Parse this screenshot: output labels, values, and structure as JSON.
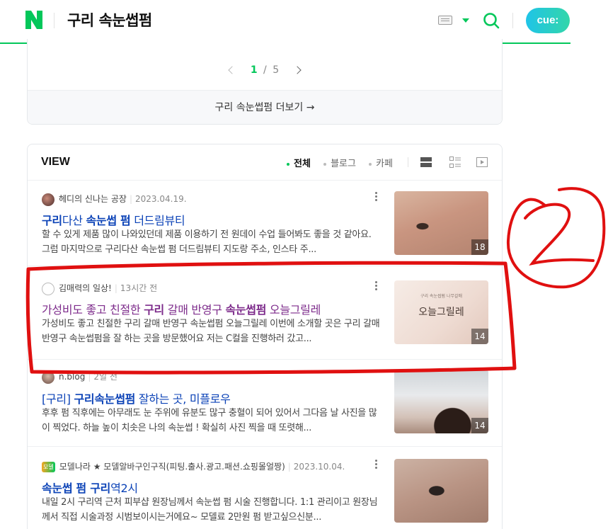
{
  "header": {
    "logo": "N",
    "query": "구리 속눈썹펌",
    "brand_color": "#03c75a",
    "cue_label": "cue:",
    "icons": [
      "keyboard-icon",
      "dropdown-caret-icon",
      "search-icon"
    ]
  },
  "pagination": {
    "current": "1",
    "separator": "/",
    "total": "5"
  },
  "more_link": {
    "label": "구리 속눈썹펌 더보기 →"
  },
  "view": {
    "title": "VIEW",
    "filters": [
      "전체",
      "블로그",
      "카페"
    ],
    "active_filter": "전체",
    "layout_icons": [
      "single-list-icon",
      "detail-list-icon",
      "video-icon"
    ]
  },
  "results": [
    {
      "author": "헤디의 신나는 공장",
      "date": "2023.04.19.",
      "title_pre": "",
      "title_hl": "구리",
      "title_mid": "다산 ",
      "title_hl2": "속눈썹 펌",
      "title_post": " 더드림뷰티",
      "desc": "할 수 있게 제품 많이 나와있던데 제품 이용하기 전 원데이 수업 들어봐도 좋을 것 같아요. 그럼 마지막으로 구리다산 속눈썹 펌 더드림뷰티 지도랑 주소, 인스타 주...",
      "count": "18",
      "visited": false
    },
    {
      "author": "김매력의 일상!",
      "date": "13시간 전",
      "title_pre": "가성비도 좋고 친절한 ",
      "title_hl": "구리",
      "title_mid": " 갈매 반영구 ",
      "title_hl2": "속눈썹펌",
      "title_post": " 오늘그릴레",
      "desc": "가성비도 좋고 친절한 구리 갈매 반영구 속눈썹펌 오늘그릴레 이번에 소개할 곳은 구리 갈매 반영구 속눈썹펌을 잘 하는 곳을 방문했어요 저는 C컬을 진행하러 갔고...",
      "count": "14",
      "thumb_caption": "구리 속눈썹펌 나무갈매",
      "thumb_text": "오늘그릴레",
      "visited": true
    },
    {
      "author": "n.blog",
      "date": "2일 전",
      "title_pre": "[구리] ",
      "title_hl": "구리속눈썹펌",
      "title_mid": " 잘하는 곳, 미플로우",
      "title_hl2": "",
      "title_post": "",
      "desc": "후후 펌 직후에는 아무래도 눈 주위에 유분도 많구 충혈이 되어 있어서 그다음 날 사진을 많이 찍었다. 하늘 높이 치솟은 나의 속눈썹 ! 확실히 사진 찍을 때 또렷해...",
      "count": "14",
      "visited": false
    },
    {
      "author": "모델나라 ★ 모델알바구인구직(피팅.출사.광고.패션.쇼핑몰얼짱)",
      "date": "2023.10.04.",
      "badge": "모델",
      "title_pre": "",
      "title_hl": "속눈썹 펌 구리",
      "title_mid": "역2시",
      "title_hl2": "",
      "title_post": "",
      "desc": "내일 2시 구리역 근처 피부샵 원장님께서 속눈썹 펌 시술 진행합니다. 1:1 관리이고 원장님께서 직접 시술과정 시범보이시는거에요~ 모델료 2만원 펌 받고싶으신분...",
      "visited": false
    }
  ],
  "annotation": {
    "label": "2",
    "color": "#e01010"
  }
}
